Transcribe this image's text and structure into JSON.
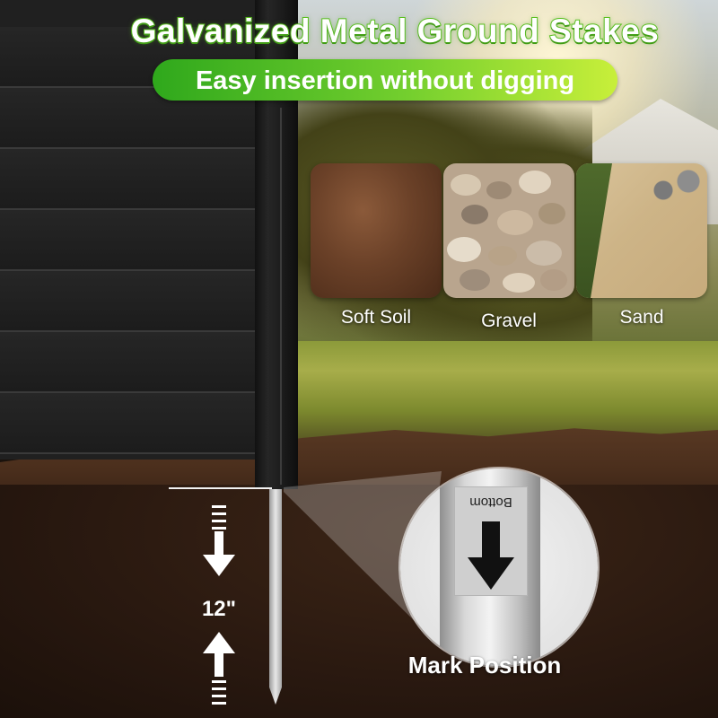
{
  "header": {
    "title": "Galvanized Metal Ground Stakes",
    "subtitle": "Easy insertion without digging"
  },
  "ground_types": [
    {
      "label": "Soft Soil"
    },
    {
      "label": "Gravel"
    },
    {
      "label": "Sand"
    }
  ],
  "measurement": {
    "depth_label": "12\""
  },
  "zoom": {
    "stake_label": "Bottom",
    "caption": "Mark Position"
  },
  "colors": {
    "title_green": "#5fc424",
    "pill_start": "#2fa81c",
    "pill_end": "#c8ef3a",
    "fence_black": "#202020",
    "soil_brown": "#2a1910"
  }
}
